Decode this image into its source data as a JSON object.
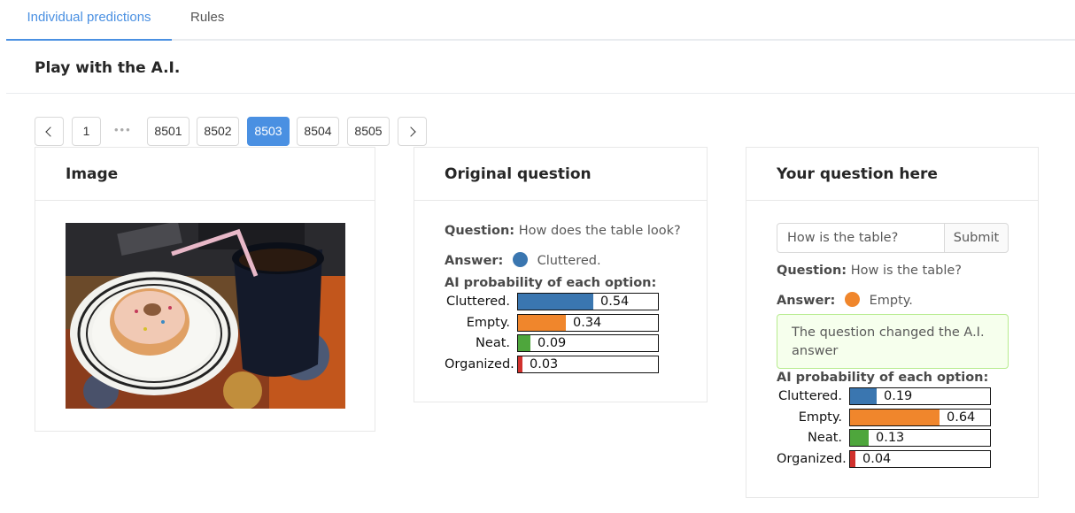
{
  "tabs": [
    {
      "label": "Individual predictions",
      "active": true
    },
    {
      "label": "Rules",
      "active": false
    }
  ],
  "page_title": "Play with the A.I.",
  "pagination": {
    "first": "1",
    "ellipsis": "•••",
    "pages": [
      "8501",
      "8502",
      "8503",
      "8504",
      "8505"
    ],
    "current": "8503"
  },
  "image_card": {
    "title": "Image"
  },
  "original_card": {
    "title": "Original question",
    "question_label": "Question:",
    "question_text": "How does the table look?",
    "answer_label": "Answer:",
    "answer_text": "Cluttered.",
    "answer_color": "#3a76b0",
    "prob_title": "AI probability of each option:",
    "options": [
      {
        "label": "Cluttered.",
        "value": 0.54,
        "value_text": "0.54",
        "color": "#3a76b0"
      },
      {
        "label": "Empty.",
        "value": 0.34,
        "value_text": "0.34",
        "color": "#f0862c"
      },
      {
        "label": "Neat.",
        "value": 0.09,
        "value_text": "0.09",
        "color": "#4ea63c"
      },
      {
        "label": "Organized.",
        "value": 0.03,
        "value_text": "0.03",
        "color": "#d0312d"
      }
    ]
  },
  "your_card": {
    "title": "Your question here",
    "input_value": "How is the table?",
    "submit_label": "Submit",
    "question_label": "Question:",
    "question_text": "How is the table?",
    "answer_label": "Answer:",
    "answer_text": "Empty.",
    "answer_color": "#f0862c",
    "alert_text": "The question changed the A.I. answer",
    "prob_title": "AI probability of each option:",
    "options": [
      {
        "label": "Cluttered.",
        "value": 0.19,
        "value_text": "0.19",
        "color": "#3a76b0"
      },
      {
        "label": "Empty.",
        "value": 0.64,
        "value_text": "0.64",
        "color": "#f0862c"
      },
      {
        "label": "Neat.",
        "value": 0.13,
        "value_text": "0.13",
        "color": "#4ea63c"
      },
      {
        "label": "Organized.",
        "value": 0.04,
        "value_text": "0.04",
        "color": "#d0312d"
      }
    ]
  },
  "colors": {
    "accent": "#4a90e2",
    "alert_bg": "#f6ffed",
    "alert_border": "#b7eb8f"
  }
}
